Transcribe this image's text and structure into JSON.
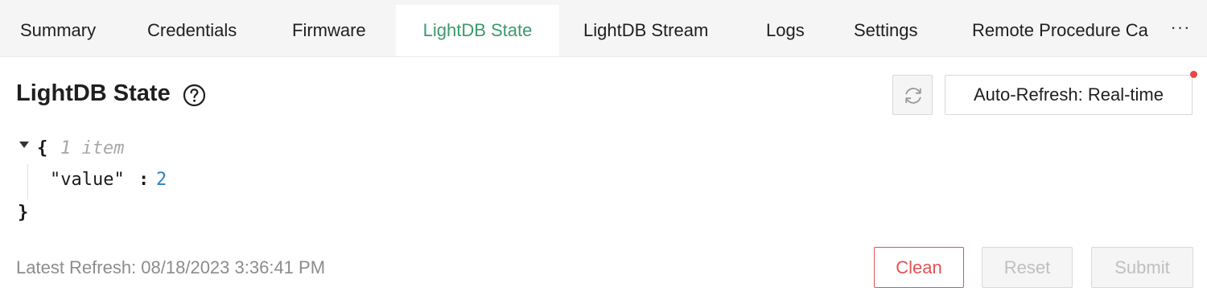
{
  "tabs": [
    {
      "label": "Summary",
      "active": false
    },
    {
      "label": "Credentials",
      "active": false
    },
    {
      "label": "Firmware",
      "active": false
    },
    {
      "label": "LightDB State",
      "active": true
    },
    {
      "label": "LightDB Stream",
      "active": false
    },
    {
      "label": "Logs",
      "active": false
    },
    {
      "label": "Settings",
      "active": false
    },
    {
      "label": "Remote Procedure Ca",
      "active": false
    }
  ],
  "more_label": "···",
  "page": {
    "title": "LightDB State",
    "help_icon": "question-circle-icon"
  },
  "toolbar": {
    "refresh_icon": "refresh-icon",
    "auto_refresh_label": "Auto-Refresh: Real-time"
  },
  "json_view": {
    "open_brace": "{",
    "item_count": "1 item",
    "key": "\"value\"",
    "colon": ":",
    "value": "2",
    "close_brace": "}"
  },
  "footer": {
    "latest_refresh": "Latest Refresh: 08/18/2023 3:36:41 PM",
    "clean_label": "Clean",
    "reset_label": "Reset",
    "submit_label": "Submit"
  },
  "colors": {
    "accent": "#3a9a6a",
    "danger": "#e15353",
    "json_number": "#2f7ec8"
  }
}
